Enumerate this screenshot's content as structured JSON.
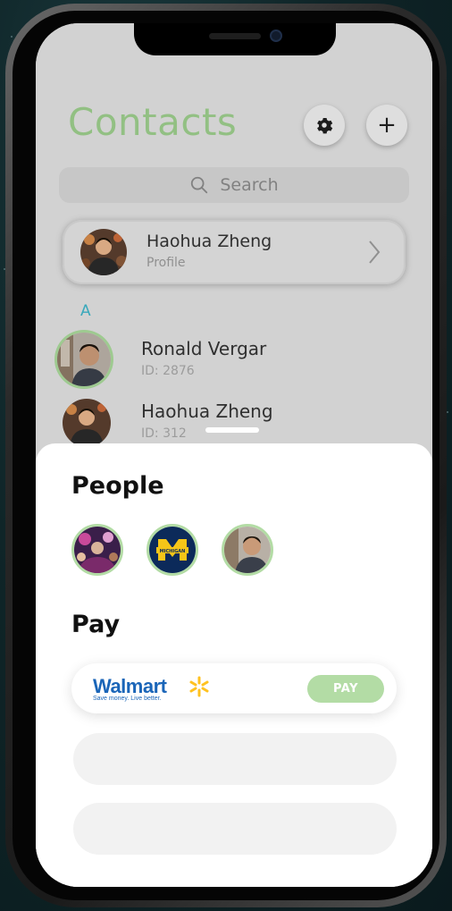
{
  "contacts": {
    "title": "Contacts",
    "settings_icon": "gear-icon",
    "add_label": "+",
    "search_placeholder": "Search",
    "profile": {
      "name": "Haohua Zheng",
      "subtitle": "Profile"
    },
    "section_letter": "A",
    "rows": [
      {
        "name": "Ronald Vergar",
        "id": "ID: 2876"
      },
      {
        "name": "Haohua Zheng",
        "id": "ID: 312"
      }
    ]
  },
  "sheet": {
    "people_title": "People",
    "people": [
      "concert-avatar",
      "michigan-logo-avatar",
      "ronald-avatar"
    ],
    "pay_title": "Pay",
    "merchant": {
      "name": "Walmart",
      "tagline": "Save money. Live better.",
      "pay_label": "PAY"
    }
  },
  "colors": {
    "accent_green": "#9ccc8c",
    "ring_green": "#b3dca5",
    "section_blue": "#3db3c7",
    "walmart_blue": "#1a65b8",
    "walmart_yellow": "#ffc220"
  }
}
